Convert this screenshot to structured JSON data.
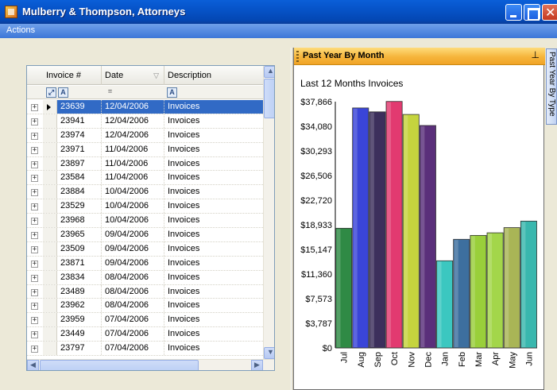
{
  "window": {
    "title": "Mulberry & Thompson, Attorneys"
  },
  "menu": {
    "items": [
      "Actions"
    ]
  },
  "grid": {
    "columns": [
      "Invoice #",
      "Date",
      "Description"
    ],
    "rows": [
      {
        "invoice": "23639",
        "date": "12/04/2006",
        "description": "Invoices",
        "selected": true
      },
      {
        "invoice": "23941",
        "date": "12/04/2006",
        "description": "Invoices"
      },
      {
        "invoice": "23974",
        "date": "12/04/2006",
        "description": "Invoices"
      },
      {
        "invoice": "23971",
        "date": "11/04/2006",
        "description": "Invoices"
      },
      {
        "invoice": "23897",
        "date": "11/04/2006",
        "description": "Invoices"
      },
      {
        "invoice": "23584",
        "date": "11/04/2006",
        "description": "Invoices"
      },
      {
        "invoice": "23884",
        "date": "10/04/2006",
        "description": "Invoices"
      },
      {
        "invoice": "23529",
        "date": "10/04/2006",
        "description": "Invoices"
      },
      {
        "invoice": "23968",
        "date": "10/04/2006",
        "description": "Invoices"
      },
      {
        "invoice": "23965",
        "date": "09/04/2006",
        "description": "Invoices"
      },
      {
        "invoice": "23509",
        "date": "09/04/2006",
        "description": "Invoices"
      },
      {
        "invoice": "23871",
        "date": "09/04/2006",
        "description": "Invoices"
      },
      {
        "invoice": "23834",
        "date": "08/04/2006",
        "description": "Invoices"
      },
      {
        "invoice": "23489",
        "date": "08/04/2006",
        "description": "Invoices"
      },
      {
        "invoice": "23962",
        "date": "08/04/2006",
        "description": "Invoices"
      },
      {
        "invoice": "23959",
        "date": "07/04/2006",
        "description": "Invoices"
      },
      {
        "invoice": "23449",
        "date": "07/04/2006",
        "description": "Invoices"
      },
      {
        "invoice": "23797",
        "date": "07/04/2006",
        "description": "Invoices"
      }
    ]
  },
  "pane": {
    "title": "Past Year By Month",
    "side_tab": "Past Year By Type"
  },
  "chart_data": {
    "type": "bar",
    "title": "Last 12 Months Invoices",
    "categories": [
      "Jul",
      "Aug",
      "Sep",
      "Oct",
      "Nov",
      "Dec",
      "Jan",
      "Feb",
      "Mar",
      "Apr",
      "May",
      "Jun"
    ],
    "values": [
      18400,
      36900,
      36300,
      37900,
      35900,
      34200,
      13400,
      16700,
      17300,
      17700,
      18500,
      19500
    ],
    "y_ticks": [
      "$0",
      "$3,787",
      "$7,573",
      "$11,360",
      "$15,147",
      "$18,933",
      "$22,720",
      "$26,506",
      "$30,293",
      "$34,080",
      "$37,866"
    ],
    "ylim": [
      0,
      37866
    ],
    "colors": [
      "#2f8a45",
      "#3a45d8",
      "#3c2f5c",
      "#e23a70",
      "#c5d43e",
      "#5a2f7a",
      "#3bc7c0",
      "#3d6f9f",
      "#99cf3a",
      "#a3d64a",
      "#a9b556",
      "#39b7ae"
    ]
  }
}
